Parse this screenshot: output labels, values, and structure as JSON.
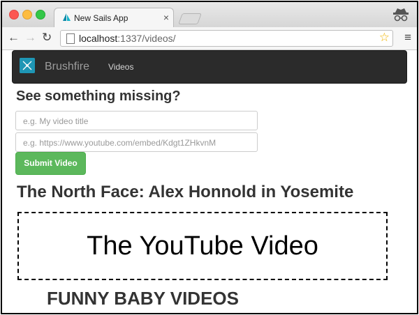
{
  "browser": {
    "tab_title": "New Sails App",
    "url_host": "localhost",
    "url_path": ":1337/videos/"
  },
  "navbar": {
    "brand": "Brushfire",
    "links": [
      "Videos"
    ]
  },
  "form": {
    "heading": "See something missing?",
    "title_placeholder": "e.g. My video title",
    "url_placeholder": "e.g. https://www.youtube.com/embed/Kdgt1ZHkvnM",
    "submit_label": "Submit Video"
  },
  "videos": [
    {
      "title": "The North Face: Alex Honnold in Yosemite",
      "embed_placeholder": "The YouTube Video"
    },
    {
      "title": "FUNNY BABY VIDEOS"
    }
  ],
  "colors": {
    "navbar_bg": "#2b2b2b",
    "brand_logo": "#1e96b5",
    "submit_button": "#5cb85c"
  }
}
